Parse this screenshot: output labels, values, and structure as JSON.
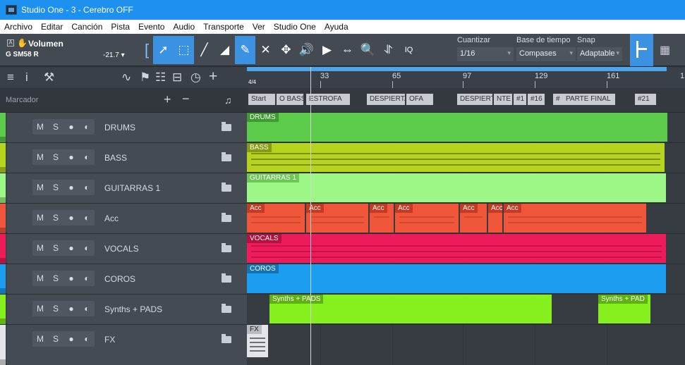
{
  "window": {
    "title": "Studio One - 3 - Cerebro OFF"
  },
  "menu": [
    "Archivo",
    "Editar",
    "Canción",
    "Pista",
    "Evento",
    "Audio",
    "Transporte",
    "Ver",
    "Studio One",
    "Ayuda"
  ],
  "instrument": {
    "name": "Volumen",
    "device": "G SM58 R",
    "volume": "-21.7"
  },
  "quantize": {
    "label": "Cuantizar",
    "value": "1/16"
  },
  "timebase": {
    "label": "Base de tiempo",
    "value": "Compases"
  },
  "snap": {
    "label": "Snap",
    "value": "Adaptable"
  },
  "marker_row": {
    "label": "Marcador"
  },
  "ruler": {
    "time_signature": "4/4",
    "bars": [
      "33",
      "65",
      "97",
      "129",
      "161",
      "1"
    ]
  },
  "markers": [
    "Start",
    "O BASS",
    "ESTROFA",
    "DESPIERTA",
    "OFA",
    "DESPIERTA",
    "NTE",
    "#1",
    "#16",
    "#",
    "PARTE FINAL",
    "#21"
  ],
  "tracks": [
    {
      "name": "DRUMS",
      "color": "#5ccb4a"
    },
    {
      "name": "BASS",
      "color": "#b6d31e"
    },
    {
      "name": "GUITARRAS 1",
      "color": "#9df787"
    },
    {
      "name": "Acc",
      "color": "#f0573a"
    },
    {
      "name": "VOCALS",
      "color": "#ee1b5a"
    },
    {
      "name": "COROS",
      "color": "#1b9ef0"
    },
    {
      "name": "Synths + PADS",
      "color": "#86f01e"
    },
    {
      "name": "FX",
      "color": "#e3e6e9"
    }
  ],
  "events": {
    "drums": "DRUMS",
    "bass": "BASS",
    "guitars": "GUITARRAS 1",
    "acc": [
      "Acc",
      "Acc",
      "Acc",
      "Acc",
      "Acc",
      "Acc",
      "Acc"
    ],
    "vocals": "VOCALS",
    "coros": "COROS",
    "synths1": "Synths + PADS",
    "synths2": "Synths + PAD",
    "fx": "FX"
  }
}
